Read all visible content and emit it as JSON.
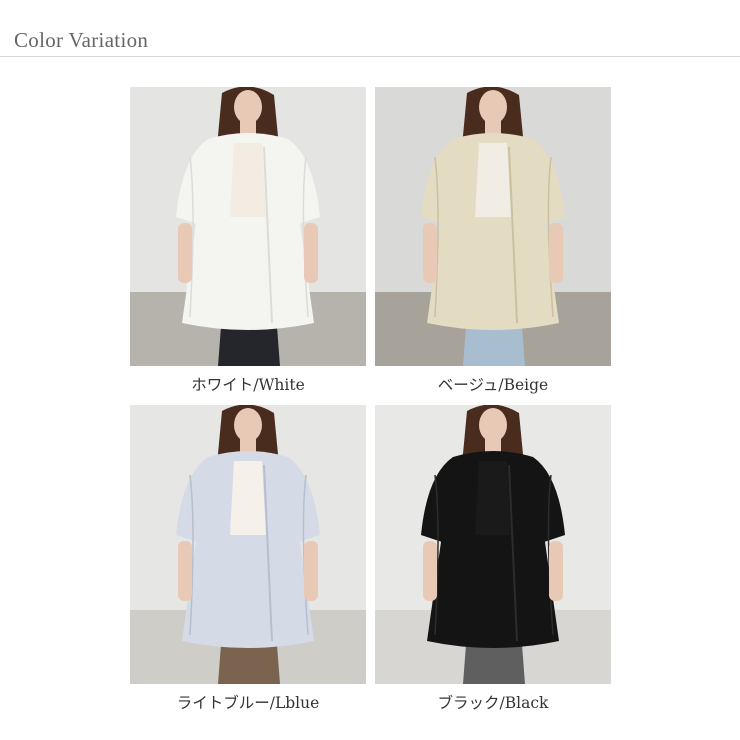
{
  "header": {
    "title": "Color Variation"
  },
  "variants": [
    {
      "label": "ホワイト/White",
      "colors": {
        "background": "#e4e4e2",
        "floor": "#b5b3ac",
        "shirt": "#f4f4f1",
        "shirt_shade": "#dcdcd7",
        "inner": "#f2ece2",
        "bottom": "#25262b",
        "hair": "#4a2c1e",
        "skin": "#e8c9b6"
      }
    },
    {
      "label": "ベージュ/Beige",
      "colors": {
        "background": "#d9d9d7",
        "floor": "#a7a39a",
        "shirt": "#e4dcc2",
        "shirt_shade": "#cbc1a1",
        "inner": "#f1ece4",
        "bottom": "#a9bdd0",
        "hair": "#4a2c1e",
        "skin": "#e8c9b6"
      }
    },
    {
      "label": "ライトブルー/Lblue",
      "colors": {
        "background": "#e6e6e4",
        "floor": "#cfcdc8",
        "shirt": "#d5dbe6",
        "shirt_shade": "#b6bfcf",
        "inner": "#f5f1ea",
        "bottom": "#7a6450",
        "hair": "#4a2c1e",
        "skin": "#e8c9b6"
      }
    },
    {
      "label": "ブラック/Black",
      "colors": {
        "background": "#e8e8e6",
        "floor": "#d8d6d2",
        "shirt": "#141414",
        "shirt_shade": "#2c2c2c",
        "inner": "#1a1a1a",
        "bottom": "#5f5f5f",
        "hair": "#4a2c1e",
        "skin": "#e8c9b6"
      }
    }
  ]
}
